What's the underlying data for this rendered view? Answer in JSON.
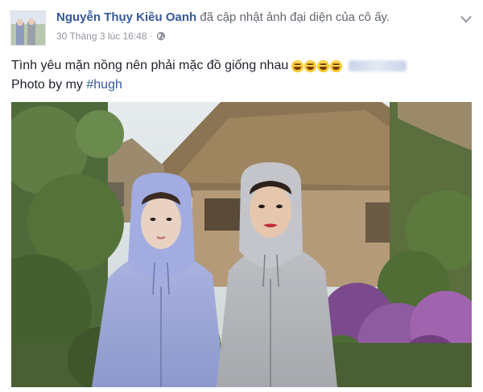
{
  "post": {
    "author": "Nguyễn Thụy Kiều Oanh",
    "action": "đã cập nhật ảnh đại diện của cô ấy.",
    "timestamp": "30 Tháng 3 lúc 16:48",
    "separator": "·",
    "privacy_icon": "globe-icon",
    "options_icon": "chevron-down-icon",
    "caption_line1": "Tình yêu mặn nồng nên phải mặc đồ giống nhau",
    "emoji_icon": "emoji-laugh-icon",
    "emoji_count": 4,
    "caption_line2_prefix": "Photo by my ",
    "hashtag": "#hugh"
  },
  "colors": {
    "link": "#365899",
    "secondary_text": "#90949c",
    "primary_text": "#1d2129"
  }
}
